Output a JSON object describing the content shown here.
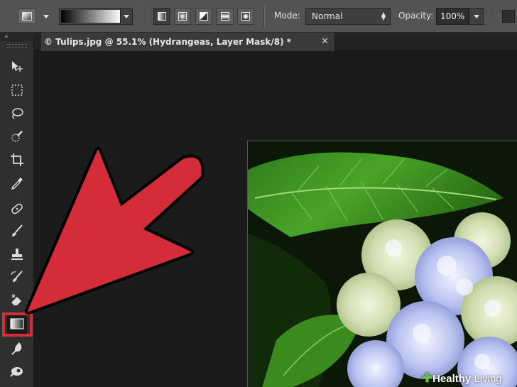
{
  "options_bar": {
    "mode_label": "Mode:",
    "mode_value": "Normal",
    "opacity_label": "Opacity:",
    "opacity_value": "100%"
  },
  "toolbox": {
    "collapse_glyph": "»",
    "tools": [
      "move-tool",
      "marquee-tool",
      "lasso-tool",
      "quick-selection-tool",
      "crop-tool",
      "eyedropper-tool",
      "spot-healing-tool",
      "brush-tool",
      "clone-stamp-tool",
      "history-brush-tool",
      "eraser-tool",
      "gradient-tool",
      "blur-tool",
      "dodge-tool"
    ],
    "selected_tool": "gradient-tool"
  },
  "document": {
    "tab_title": "© Tulips.jpg @ 55.1% (Hydrangeas, Layer Mask/8) *",
    "close_glyph": "✕"
  },
  "annotation": {
    "arrow_color": "#d52c3a",
    "highlight_color": "#d52c3a"
  },
  "watermark": {
    "prefix": "Healthy",
    "suffix": " Living"
  },
  "colors": {
    "panel": "#535353",
    "toolbox": "#2f2f2f",
    "canvas": "#1b1b1b"
  }
}
